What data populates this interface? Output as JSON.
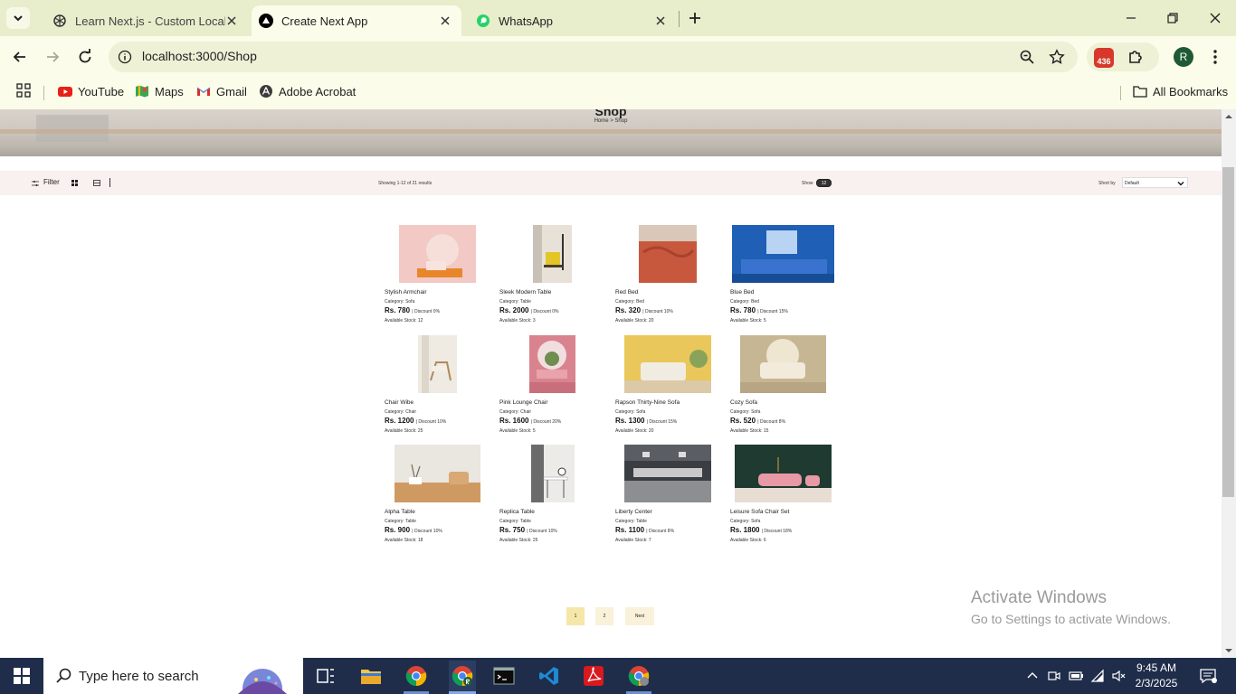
{
  "browser": {
    "tabs": [
      {
        "title": "Learn Next.js - Custom Localho",
        "icon": "openai-icon",
        "active": false
      },
      {
        "title": "Create Next App",
        "icon": "vercel-triangle-icon",
        "active": true
      },
      {
        "title": "WhatsApp",
        "icon": "whatsapp-icon",
        "active": false
      }
    ],
    "url": "localhost:3000/Shop",
    "extension_badge": "436",
    "profile_initial": "R",
    "bookmarks": [
      {
        "label": "YouTube",
        "icon": "youtube-icon"
      },
      {
        "label": "Maps",
        "icon": "maps-icon"
      },
      {
        "label": "Gmail",
        "icon": "gmail-icon"
      },
      {
        "label": "Adobe Acrobat",
        "icon": "acrobat-icon"
      }
    ],
    "all_bookmarks": "All Bookmarks"
  },
  "page": {
    "hero": {
      "title": "Shop",
      "breadcrumb": "Home  >  Shop"
    },
    "filterbar": {
      "filter_label": "Filter",
      "showing": "Showing 1-12 of 21 results",
      "show_label": "Show",
      "show_value": "12",
      "sort_label": "Short by",
      "sort_value": "Default"
    },
    "products": [
      {
        "name": "Stylish Armchair",
        "category": "Category: Sofa",
        "price": "Rs. 780",
        "discount": "| Discount 0%",
        "stock": "Available Stock: 12"
      },
      {
        "name": "Sleek Modern Table",
        "category": "Category: Table",
        "price": "Rs. 2000",
        "discount": "| Discount 0%",
        "stock": "Available Stock: 3"
      },
      {
        "name": "Red Bed",
        "category": "Category: Bed",
        "price": "Rs. 320",
        "discount": "| Discount 10%",
        "stock": "Available Stock: 20"
      },
      {
        "name": "Blue Bed",
        "category": "Category: Bed",
        "price": "Rs. 780",
        "discount": "| Discount 15%",
        "stock": "Available Stock: 5"
      },
      {
        "name": "Chair Wibe",
        "category": "Category: Chair",
        "price": "Rs. 1200",
        "discount": "| Discount 10%",
        "stock": "Available Stock: 25"
      },
      {
        "name": "Pink Lounge Chair",
        "category": "Category: Chair",
        "price": "Rs. 1600",
        "discount": "| Discount 20%",
        "stock": "Available Stock: 5"
      },
      {
        "name": "Rapson Thirty-Nine Sofa",
        "category": "Category: Sofa",
        "price": "Rs. 1300",
        "discount": "| Discount 15%",
        "stock": "Available Stock: 20"
      },
      {
        "name": "Cozy Sofa",
        "category": "Category: Sofa",
        "price": "Rs. 520",
        "discount": "| Discount 8%",
        "stock": "Available Stock: 15"
      },
      {
        "name": "Alpha Table",
        "category": "Category: Table",
        "price": "Rs. 900",
        "discount": "| Discount 10%",
        "stock": "Available Stock: 18"
      },
      {
        "name": "Replica Table",
        "category": "Category: Table",
        "price": "Rs. 750",
        "discount": "| Discount 10%",
        "stock": "Available Stock: 25"
      },
      {
        "name": "Liberty Center",
        "category": "Category: Table",
        "price": "Rs. 1100",
        "discount": "| Discount 8%",
        "stock": "Available Stock: 7"
      },
      {
        "name": "Leisure Sofa Chair Set",
        "category": "Category: Sofa",
        "price": "Rs. 1800",
        "discount": "| Discount 18%",
        "stock": "Available Stock: 6"
      }
    ],
    "pagination": {
      "pages": [
        "1",
        "2"
      ],
      "next": "Next",
      "current": "1"
    }
  },
  "watermark": {
    "line1": "Activate Windows",
    "line2": "Go to Settings to activate Windows."
  },
  "taskbar": {
    "search_placeholder": "Type here to search",
    "time": "9:45 AM",
    "date": "2/3/2025"
  }
}
